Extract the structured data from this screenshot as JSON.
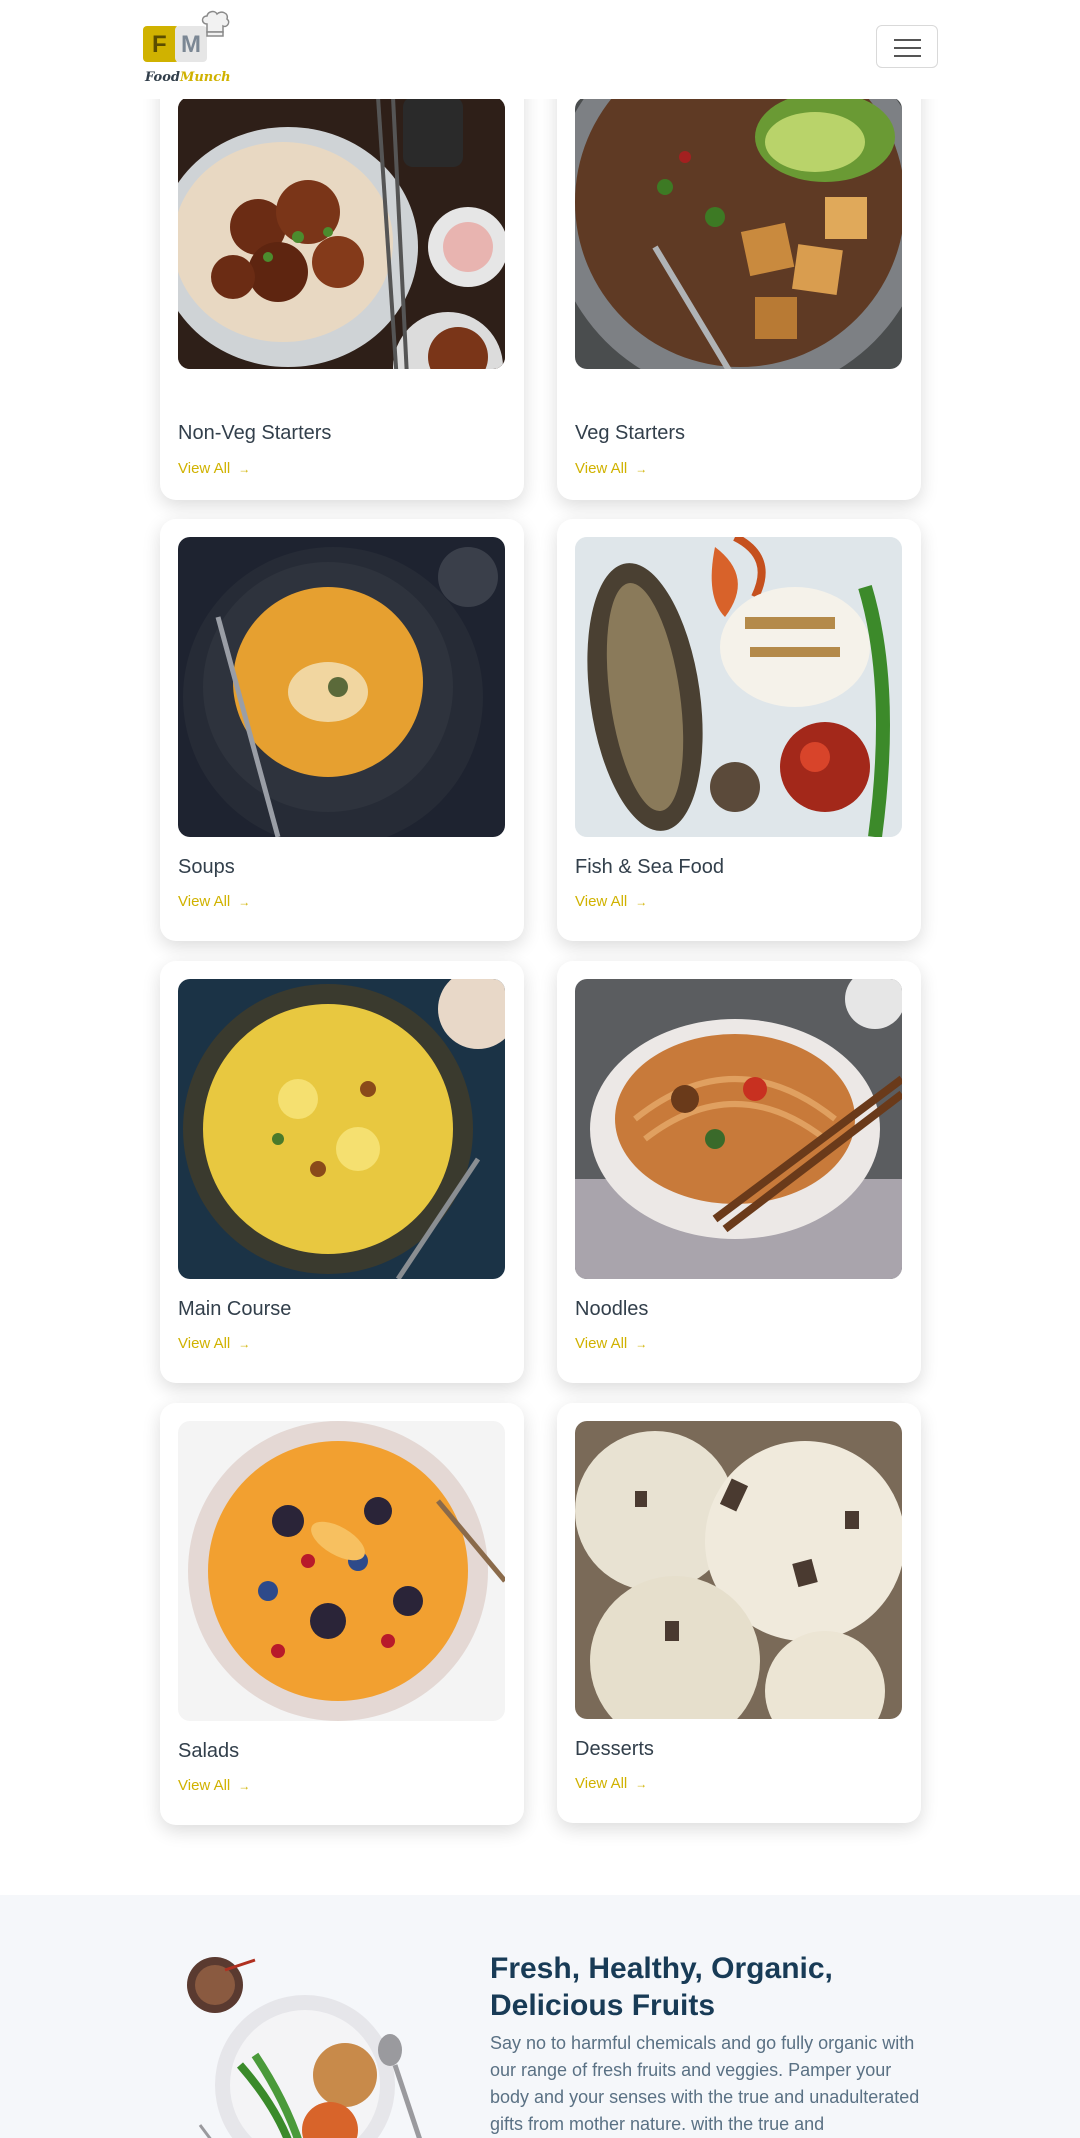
{
  "brand": {
    "logo_letter_1": "F",
    "logo_letter_2": "M",
    "name_part_1": "Food",
    "name_part_2": "Munch",
    "accent_color": "#d0b200"
  },
  "menu": {
    "toggle_icon": "hamburger-menu-icon"
  },
  "categories": [
    {
      "title": "Non-Veg Starters",
      "link": "View All"
    },
    {
      "title": "Veg Starters",
      "link": "View All"
    },
    {
      "title": "Soups",
      "link": "View All"
    },
    {
      "title": "Fish & Sea Food",
      "link": "View All"
    },
    {
      "title": "Main Course",
      "link": "View All"
    },
    {
      "title": "Noodles",
      "link": "View All"
    },
    {
      "title": "Salads",
      "link": "View All"
    },
    {
      "title": "Desserts",
      "link": "View All"
    }
  ],
  "link_arrow": "→",
  "fruits_section": {
    "title": "Fresh, Healthy, Organic, Delicious Fruits",
    "description": "Say no to harmful chemicals and go fully organic with our range of fresh fruits and veggies. Pamper your body and your senses with the true and unadulterated gifts from mother nature. with the true and"
  }
}
